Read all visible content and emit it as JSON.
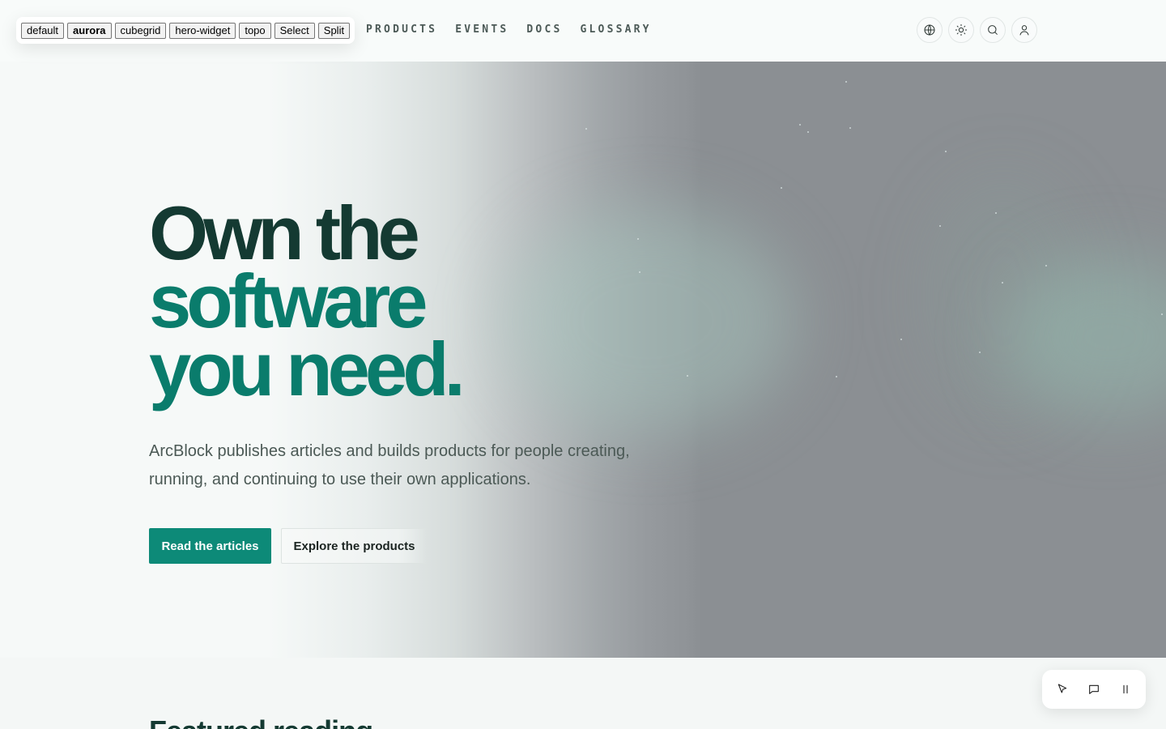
{
  "nav": {
    "links": [
      {
        "label": "PRODUCTS",
        "name": "nav-products"
      },
      {
        "label": "EVENTS",
        "name": "nav-events"
      },
      {
        "label": "DOCS",
        "name": "nav-docs"
      },
      {
        "label": "GLOSSARY",
        "name": "nav-glossary"
      }
    ],
    "actions": [
      {
        "icon": "globe-icon"
      },
      {
        "icon": "sun-icon"
      },
      {
        "icon": "search-icon"
      },
      {
        "icon": "user-icon"
      }
    ]
  },
  "switcher": {
    "options": [
      "default",
      "aurora",
      "cubegrid",
      "hero-widget",
      "topo",
      "Select",
      "Split"
    ],
    "active": "aurora"
  },
  "hero": {
    "headline_line1": "Own the",
    "headline_line2": "software",
    "headline_line3": "you need.",
    "lede": "ArcBlock publishes articles and builds products for people creating, running, and continuing to use their own applications.",
    "primary_cta": "Read the articles",
    "secondary_cta": "Explore the products",
    "colors": {
      "headline_dark": "#143a32",
      "headline_accent": "#0a7c6c",
      "primary_button": "#0d8a78"
    }
  },
  "next_section": {
    "title": "Featured reading"
  },
  "toolbar": {
    "tools": [
      "pointer-icon",
      "comment-icon",
      "pause-icon"
    ]
  }
}
